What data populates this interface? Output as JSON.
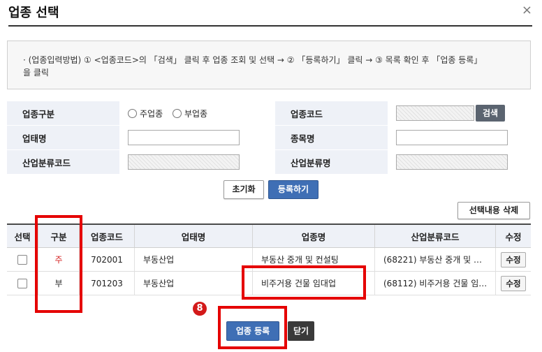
{
  "dialog": {
    "title": "업종 선택",
    "close_icon": "×"
  },
  "info": {
    "line1": "· (업종입력방법) ① <업종코드>의 「검색」 클릭 후 업종 조회 및 선택 → ② 「등록하기」 클릭 → ③ 목록 확인 후 「업종 등록」",
    "line2": "을 클릭"
  },
  "form": {
    "category_label": "업종구분",
    "radio_main": "주업종",
    "radio_sub": "부업종",
    "code_label": "업종코드",
    "search_button": "검색",
    "business_type_label": "업태명",
    "item_label": "종목명",
    "industry_code_label": "산업분류코드",
    "industry_name_label": "산업분류명"
  },
  "actions": {
    "reset": "초기화",
    "register": "등록하기",
    "delete_selected": "선택내용 삭제"
  },
  "table": {
    "headers": [
      "선택",
      "구분",
      "업종코드",
      "업태명",
      "업종명",
      "산업분류코드",
      "수정"
    ],
    "rows": [
      {
        "type": "주",
        "code": "702001",
        "business": "부동산업",
        "name": "부동산 중개 및 컨설팅",
        "industry": "(68221) 부동산 중개 및 …",
        "edit": "수정"
      },
      {
        "type": "부",
        "code": "701203",
        "business": "부동산업",
        "name": "비주거용 건물 임대업",
        "industry": "(68112) 비주거용 건물 임…",
        "edit": "수정"
      }
    ]
  },
  "footer": {
    "step_badge": "8",
    "confirm": "업종 등록",
    "close": "닫기"
  },
  "colors": {
    "highlight": "#e50000",
    "primary": "#3f6fb5",
    "header_bg": "#eef1f7"
  }
}
